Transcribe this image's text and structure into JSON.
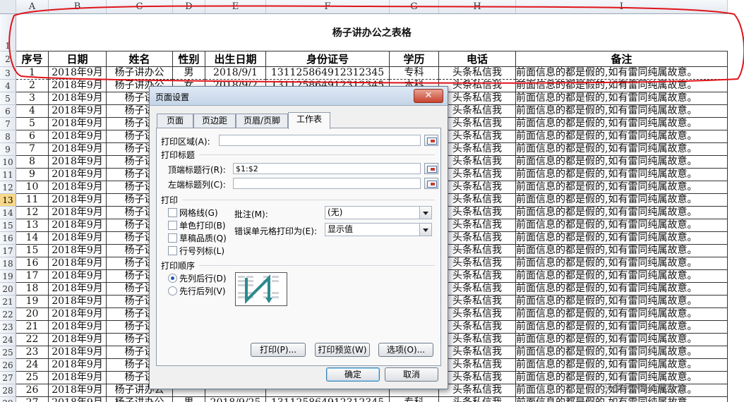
{
  "columns": [
    "A",
    "B",
    "C",
    "D",
    "E",
    "F",
    "G",
    "H",
    "I"
  ],
  "sheet_title": "杨子讲办公之表格",
  "headers": [
    "序号",
    "日期",
    "姓名",
    "性别",
    "出生日期",
    "身份证号",
    "学历",
    "电话",
    "备注"
  ],
  "rows": [
    {
      "r": "3",
      "no": "1",
      "date": "2018年9月",
      "name": "杨子讲办公",
      "sex": "男",
      "birth": "2018/9/1",
      "id": "131125864912312345",
      "edu": "专科",
      "phone": "头条私信我",
      "note": "前面信息的都是假的,如有雷同纯属故意。"
    },
    {
      "r": "4",
      "no": "2",
      "date": "2018年9月",
      "name": "杨子讲办公",
      "sex": "女",
      "birth": "2018/9/2",
      "id": "131125864912312345",
      "edu": "本科",
      "phone": "头条私信我",
      "note": "前面信息的都是假的,如有雷同纯属故意。"
    },
    {
      "r": "5",
      "no": "3",
      "date": "2018年9月",
      "name": "杨子讲",
      "sex": "",
      "birth": "",
      "id": "",
      "edu": "",
      "phone": "头条私信我",
      "note": "前面信息的都是假的,如有雷同纯属故意。"
    },
    {
      "r": "6",
      "no": "4",
      "date": "2018年9月",
      "name": "杨子讲",
      "sex": "",
      "birth": "",
      "id": "",
      "edu": "",
      "phone": "头条私信我",
      "note": "前面信息的都是假的,如有雷同纯属故意。"
    },
    {
      "r": "7",
      "no": "5",
      "date": "2018年9月",
      "name": "杨子讲",
      "sex": "",
      "birth": "",
      "id": "",
      "edu": "",
      "phone": "头条私信我",
      "note": "前面信息的都是假的,如有雷同纯属故意。"
    },
    {
      "r": "8",
      "no": "6",
      "date": "2018年9月",
      "name": "杨子讲",
      "sex": "",
      "birth": "",
      "id": "",
      "edu": "",
      "phone": "头条私信我",
      "note": "前面信息的都是假的,如有雷同纯属故意。"
    },
    {
      "r": "9",
      "no": "7",
      "date": "2018年9月",
      "name": "杨子讲",
      "sex": "",
      "birth": "",
      "id": "",
      "edu": "",
      "phone": "头条私信我",
      "note": "前面信息的都是假的,如有雷同纯属故意。"
    },
    {
      "r": "10",
      "no": "8",
      "date": "2018年9月",
      "name": "杨子讲",
      "sex": "",
      "birth": "",
      "id": "",
      "edu": "",
      "phone": "头条私信我",
      "note": "前面信息的都是假的,如有雷同纯属故意。"
    },
    {
      "r": "11",
      "no": "9",
      "date": "2018年9月",
      "name": "杨子讲",
      "sex": "",
      "birth": "",
      "id": "",
      "edu": "",
      "phone": "头条私信我",
      "note": "前面信息的都是假的,如有雷同纯属故意。"
    },
    {
      "r": "12",
      "no": "10",
      "date": "2018年9月",
      "name": "杨子讲",
      "sex": "",
      "birth": "",
      "id": "",
      "edu": "",
      "phone": "头条私信我",
      "note": "前面信息的都是假的,如有雷同纯属故意。"
    },
    {
      "r": "13",
      "no": "11",
      "date": "2018年9月",
      "name": "杨子讲",
      "sex": "",
      "birth": "",
      "id": "",
      "edu": "",
      "phone": "头条私信我",
      "note": "前面信息的都是假的,如有雷同纯属故意。"
    },
    {
      "r": "14",
      "no": "12",
      "date": "2018年9月",
      "name": "杨子讲",
      "sex": "",
      "birth": "",
      "id": "",
      "edu": "",
      "phone": "头条私信我",
      "note": "前面信息的都是假的,如有雷同纯属故意。"
    },
    {
      "r": "15",
      "no": "13",
      "date": "2018年9月",
      "name": "杨子讲",
      "sex": "",
      "birth": "",
      "id": "",
      "edu": "",
      "phone": "头条私信我",
      "note": "前面信息的都是假的,如有雷同纯属故意。"
    },
    {
      "r": "16",
      "no": "14",
      "date": "2018年9月",
      "name": "杨子讲",
      "sex": "",
      "birth": "",
      "id": "",
      "edu": "",
      "phone": "头条私信我",
      "note": "前面信息的都是假的,如有雷同纯属故意。"
    },
    {
      "r": "17",
      "no": "15",
      "date": "2018年9月",
      "name": "杨子讲",
      "sex": "",
      "birth": "",
      "id": "",
      "edu": "",
      "phone": "头条私信我",
      "note": "前面信息的都是假的,如有雷同纯属故意。"
    },
    {
      "r": "18",
      "no": "16",
      "date": "2018年9月",
      "name": "杨子讲",
      "sex": "",
      "birth": "",
      "id": "",
      "edu": "",
      "phone": "头条私信我",
      "note": "前面信息的都是假的,如有雷同纯属故意。"
    },
    {
      "r": "19",
      "no": "17",
      "date": "2018年9月",
      "name": "杨子讲",
      "sex": "",
      "birth": "",
      "id": "",
      "edu": "",
      "phone": "头条私信我",
      "note": "前面信息的都是假的,如有雷同纯属故意。"
    },
    {
      "r": "20",
      "no": "18",
      "date": "2018年9月",
      "name": "杨子讲",
      "sex": "",
      "birth": "",
      "id": "",
      "edu": "",
      "phone": "头条私信我",
      "note": "前面信息的都是假的,如有雷同纯属故意。"
    },
    {
      "r": "21",
      "no": "19",
      "date": "2018年9月",
      "name": "杨子讲",
      "sex": "",
      "birth": "",
      "id": "",
      "edu": "",
      "phone": "头条私信我",
      "note": "前面信息的都是假的,如有雷同纯属故意。"
    },
    {
      "r": "22",
      "no": "20",
      "date": "2018年9月",
      "name": "杨子讲",
      "sex": "",
      "birth": "",
      "id": "",
      "edu": "",
      "phone": "头条私信我",
      "note": "前面信息的都是假的,如有雷同纯属故意。"
    },
    {
      "r": "23",
      "no": "21",
      "date": "2018年9月",
      "name": "杨子讲",
      "sex": "",
      "birth": "",
      "id": "",
      "edu": "",
      "phone": "头条私信我",
      "note": "前面信息的都是假的,如有雷同纯属故意。"
    },
    {
      "r": "24",
      "no": "22",
      "date": "2018年9月",
      "name": "杨子讲",
      "sex": "",
      "birth": "",
      "id": "",
      "edu": "",
      "phone": "头条私信我",
      "note": "前面信息的都是假的,如有雷同纯属故意。"
    },
    {
      "r": "25",
      "no": "23",
      "date": "2018年9月",
      "name": "杨子讲",
      "sex": "",
      "birth": "",
      "id": "",
      "edu": "",
      "phone": "头条私信我",
      "note": "前面信息的都是假的,如有雷同纯属故意。"
    },
    {
      "r": "26",
      "no": "24",
      "date": "2018年9月",
      "name": "杨子讲",
      "sex": "",
      "birth": "",
      "id": "",
      "edu": "",
      "phone": "头条私信我",
      "note": "前面信息的都是假的,如有雷同纯属故意。"
    },
    {
      "r": "27",
      "no": "25",
      "date": "2018年9月",
      "name": "杨子讲",
      "sex": "",
      "birth": "",
      "id": "",
      "edu": "",
      "phone": "头条私信我",
      "note": "前面信息的都是假的,如有雷同纯属故意。"
    },
    {
      "r": "28",
      "no": "26",
      "date": "2018年9月",
      "name": "杨子讲办公",
      "sex": "",
      "birth": "",
      "id": "",
      "edu": "",
      "phone": "头条私信我",
      "note": "前面信息的都是假的,如有雷同纯属故意。"
    },
    {
      "r": "29",
      "no": "27",
      "date": "2018年9月",
      "name": "杨子讲办公",
      "sex": "男",
      "birth": "2018/9/25",
      "id": "131125864912312345",
      "edu": "专科",
      "phone": "头条私信我",
      "note": "前面信息的都是假的,如有雷同纯属故意。"
    }
  ],
  "dialog": {
    "title": "页面设置",
    "close": "✕",
    "tabs": [
      "页面",
      "页边距",
      "页眉/页脚",
      "工作表"
    ],
    "print_area_label": "打印区域(A):",
    "print_area_value": "",
    "print_titles_section": "打印标题",
    "top_rows_label": "顶端标题行(R):",
    "top_rows_value": "$1:$2",
    "left_cols_label": "左端标题列(C):",
    "left_cols_value": "",
    "print_section": "打印",
    "gridlines": "网格线(G)",
    "mono": "单色打印(B)",
    "draft": "草稿品质(Q)",
    "rowcol": "行号列标(L)",
    "comments_label": "批注(M):",
    "comments_value": "(无)",
    "errors_label": "错误单元格打印为(E):",
    "errors_value": "显示值",
    "order_section": "打印顺序",
    "down_then_over": "先列后行(D)",
    "over_then_down": "先行后列(V)",
    "btn_print": "打印(P)...",
    "btn_preview": "打印预览(W)",
    "btn_options": "选项(O)...",
    "btn_ok": "确定",
    "btn_cancel": "取消"
  },
  "watermark": "头条号/杨子讲办公",
  "colors": {
    "annotation": "#e0141a",
    "accent": "#2256b8"
  }
}
